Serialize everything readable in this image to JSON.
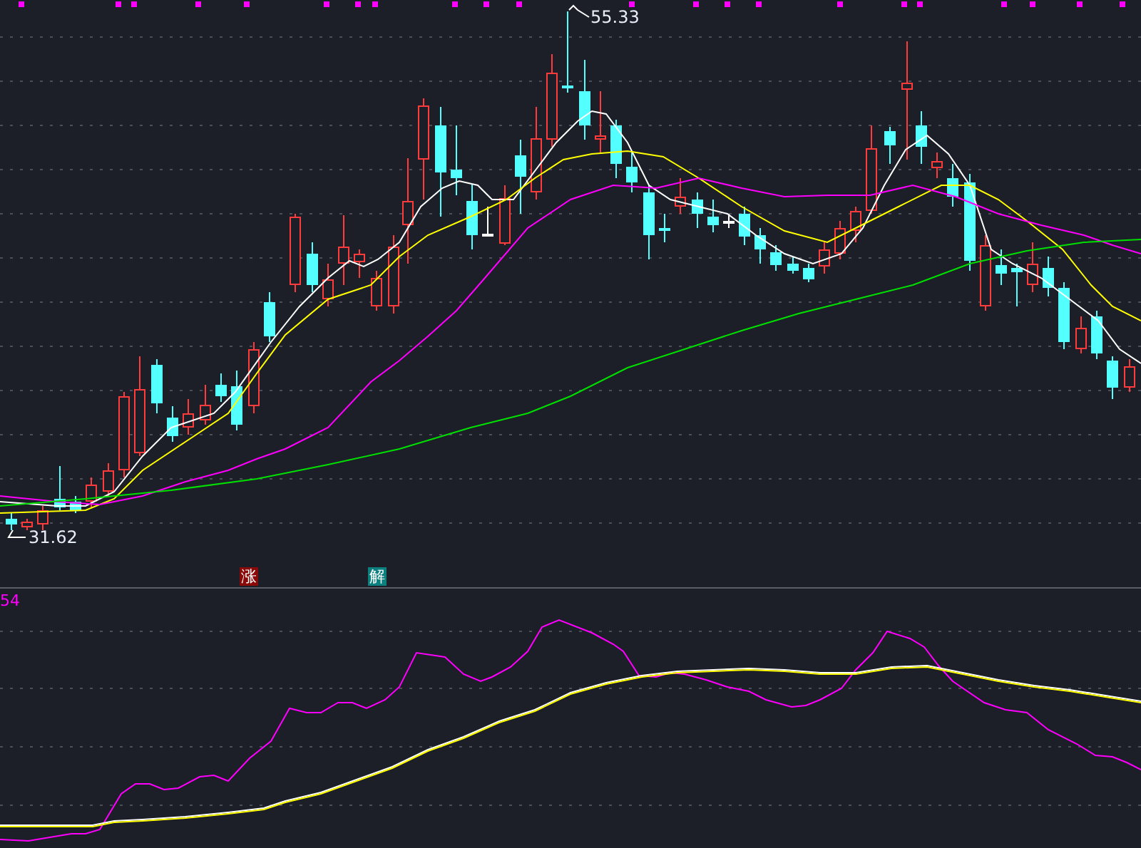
{
  "price_chart": {
    "high_label": "55.33",
    "low_label": "31.62",
    "markers": [
      {
        "text": "涨",
        "kind": "rise"
      },
      {
        "text": "解",
        "kind": "unlock"
      }
    ]
  },
  "indicator_panel": {
    "value_label": "54"
  }
}
